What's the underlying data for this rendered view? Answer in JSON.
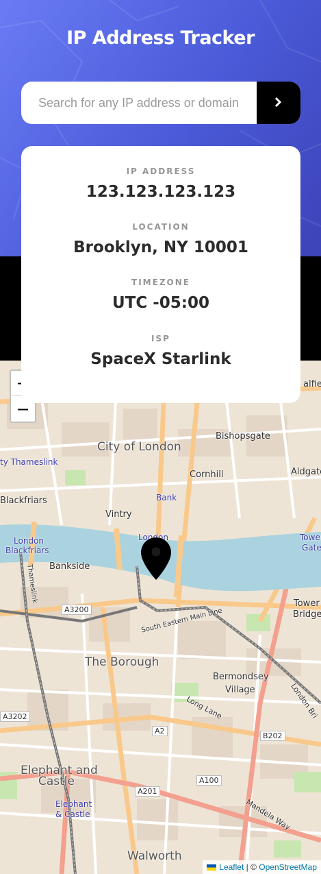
{
  "header": {
    "title": "IP Address Tracker"
  },
  "search": {
    "placeholder": "Search for any IP address or domain",
    "value": ""
  },
  "info": {
    "ip_label": "IP ADDRESS",
    "ip_value": "123.123.123.123",
    "location_label": "LOCATION",
    "location_value": "Brooklyn, NY 10001",
    "timezone_label": "TIMEZONE",
    "timezone_value": "UTC -05:00",
    "isp_label": "ISP",
    "isp_value": "SpaceX Starlink"
  },
  "map": {
    "zoom_in": "+",
    "zoom_out": "−",
    "labels": {
      "city_of_london": "City of London",
      "bishopsgate": "Bishopsgate",
      "aldgate": "Aldgate",
      "cornhill": "Cornhill",
      "city_thameslink": "ty Thameslink",
      "blackfriars": "Blackfriars",
      "vintry": "Vintry",
      "bank": "Bank",
      "london_blackfriars_1": "London",
      "london_blackfriars_2": "Blackfriars",
      "london_station": "London",
      "bankside": "Bankside",
      "tower_gate": "Tower",
      "gate": "Gate",
      "tower_bridge_1": "Tower",
      "tower_bridge_2": "Bridge",
      "a3200": "A3200",
      "south_eastern": "South Eastern Main Line",
      "thameslink": "Thameslink",
      "the_borough": "The Borough",
      "bermondsey_1": "Bermondsey",
      "bermondsey_2": "Village",
      "a3202": "A3202",
      "long_lane": "Long Lane",
      "a2": "A2",
      "b202": "B202",
      "london_bridge": "London Bri",
      "elephant_1": "Elephant and",
      "elephant_2": "Castle",
      "elephant_st_1": "Elephant",
      "elephant_st_2": "& Castle",
      "a100": "A100",
      "a201": "A201",
      "mandela_way": "Mandela Way",
      "walworth": "Walworth",
      "spitalfields": "alfiel"
    },
    "attribution": {
      "leaflet": "Leaflet",
      "separator": " | © ",
      "osm": "OpenStreetMap"
    },
    "colors": {
      "land": "#efe6d8",
      "river": "#aad3df",
      "major_road": "#f9c98b",
      "primary_road": "#f3a08f",
      "rail": "#777777",
      "park": "#c8e6b0"
    },
    "marker_icon": "location-pin-icon"
  },
  "colors": {
    "header_gradient_start": "#6a7bf5",
    "header_gradient_end": "#3d43b8",
    "button": "#000000",
    "label_gray": "#969696",
    "value_dark": "#2b2b2b"
  }
}
